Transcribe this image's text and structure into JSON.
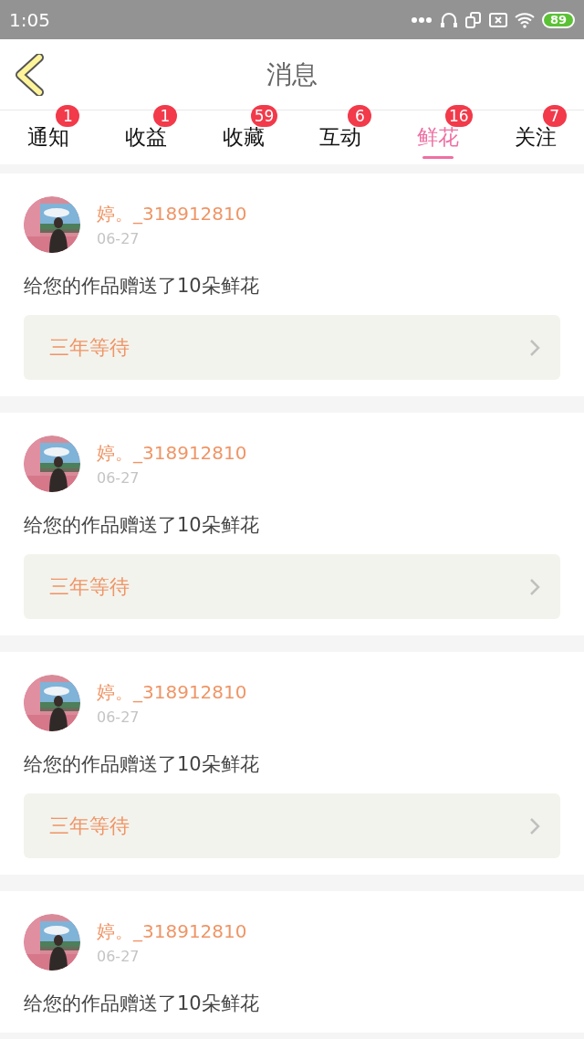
{
  "status_bar": {
    "time": "1:05",
    "battery": "89"
  },
  "header": {
    "title": "消息"
  },
  "tabs": [
    {
      "label": "通知",
      "badge": "1",
      "selected": false
    },
    {
      "label": "收益",
      "badge": "1",
      "selected": false
    },
    {
      "label": "收藏",
      "badge": "59",
      "selected": false
    },
    {
      "label": "互动",
      "badge": "6",
      "selected": false
    },
    {
      "label": "鲜花",
      "badge": "16",
      "selected": true
    },
    {
      "label": "关注",
      "badge": "7",
      "selected": false
    }
  ],
  "messages": [
    {
      "user": "婷。_318912810",
      "date": "06-27",
      "text": "给您的作品赠送了10朵鲜花",
      "work": "三年等待"
    },
    {
      "user": "婷。_318912810",
      "date": "06-27",
      "text": "给您的作品赠送了10朵鲜花",
      "work": "三年等待"
    },
    {
      "user": "婷。_318912810",
      "date": "06-27",
      "text": "给您的作品赠送了10朵鲜花",
      "work": "三年等待"
    },
    {
      "user": "婷。_318912810",
      "date": "06-27",
      "text": "给您的作品赠送了10朵鲜花"
    }
  ]
}
